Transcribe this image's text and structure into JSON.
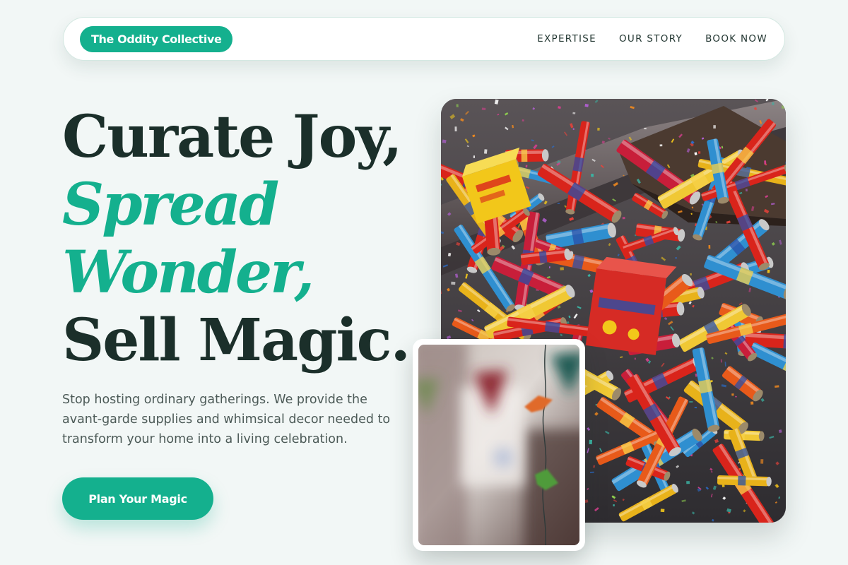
{
  "nav": {
    "brand": "The Oddity Collective",
    "links": [
      "EXPERTISE",
      "OUR STORY",
      "BOOK NOW"
    ]
  },
  "hero": {
    "headline": {
      "line1": "Curate Joy,",
      "line2": "Spread",
      "line3": "Wonder,",
      "line4": "Sell Magic."
    },
    "lead": "Stop hosting ordinary gatherings. We provide the avant-garde supplies and whimsical decor needed to transform your home into a living celebration.",
    "cta_label": "Plan Your Magic"
  },
  "images": {
    "main": "party-poppers-photo",
    "secondary": "bunting-decor-photo"
  },
  "colors": {
    "accent": "#14b08e",
    "heading": "#1b2f2a",
    "body_text": "#4c5a57",
    "background": "#f2f7f6"
  }
}
